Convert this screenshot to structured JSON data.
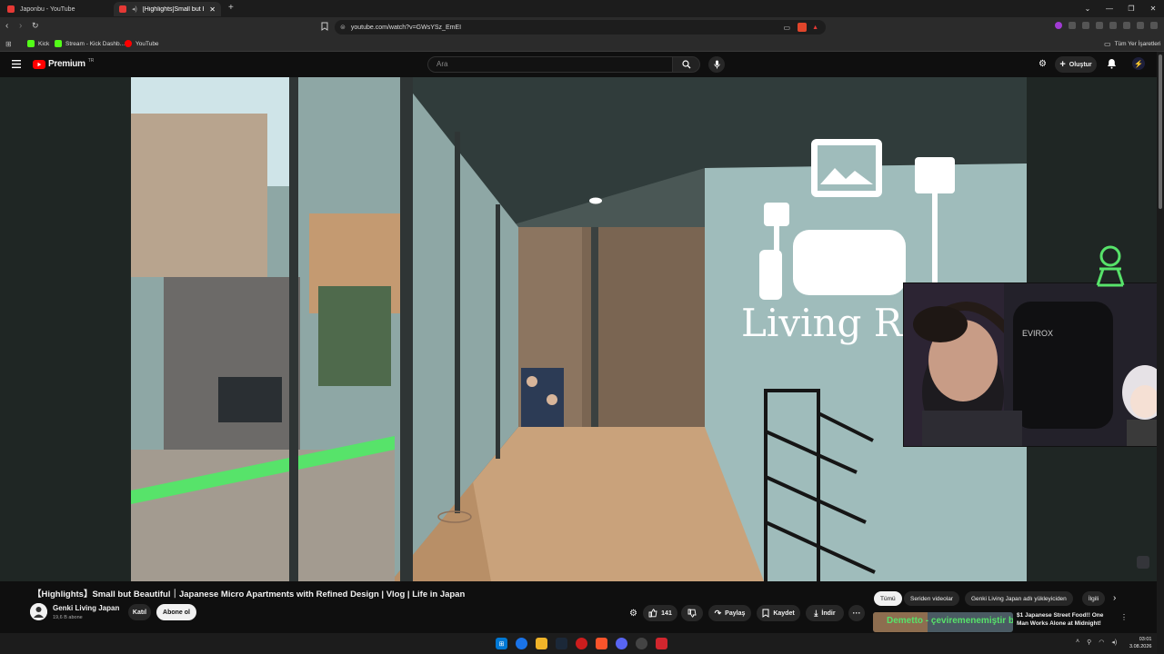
{
  "browser": {
    "tabs": [
      {
        "label": "Japonbu - YouTube",
        "active": false
      },
      {
        "label": "[Highlights]Small but Beautif",
        "active": true
      }
    ],
    "url": "youtube.com/watch?v=GWsYSz_EmEI",
    "bookmarks": [
      "Kick",
      "Stream - Kick Dashb...",
      "YouTube"
    ],
    "bookmarks_folder": "Tüm Yer İşaretleri"
  },
  "youtube": {
    "logo_text": "Premium",
    "logo_badge": "TR",
    "search_placeholder": "Ara",
    "create_label": "Oluştur"
  },
  "video": {
    "overlay_text": "Living Ro",
    "webcam_brand": "EVIROX"
  },
  "watch": {
    "title": "【Highlights】Small but Beautiful｜Japanese Micro Apartments with Refined Design | Vlog | Life in Japan",
    "channel_name": "Genki Living Japan",
    "subscribers": "19,6 B abone",
    "join_label": "Katıl",
    "subscribe_label": "Abone ol",
    "like_count": "141",
    "share_label": "Paylaş",
    "save_label": "Kaydet",
    "download_label": "İndir"
  },
  "chips": [
    "Tümü",
    "Seriden videolar",
    "Genki Living Japan adlı yükleyiciden",
    "İlgili"
  ],
  "sidebar_video": {
    "title_line1": "$1 Japanese Street Food!! One",
    "title_line2": "Man Works Alone at Midnight!"
  },
  "chat_overlay": "Demetto - çeviremenemiştir belki",
  "taskbar": {
    "time": "03:01",
    "date": "3.08.2026"
  },
  "colors": {
    "youtube_red": "#ff0000",
    "accent_green": "#57e36a",
    "sky_blue": "#cfe4e8"
  }
}
